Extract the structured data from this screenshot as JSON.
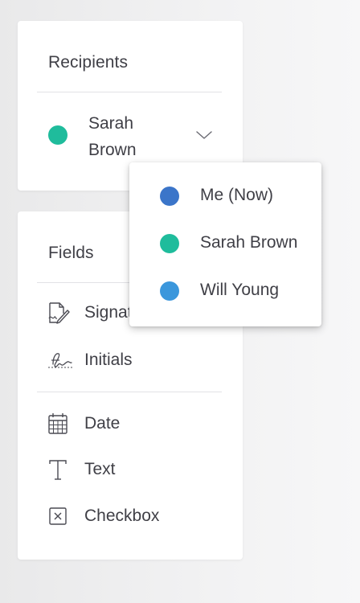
{
  "recipients_panel": {
    "title": "Recipients",
    "selected": {
      "name": "Sarah Brown",
      "color": "#1fbc9c"
    },
    "dropdown_icon": "chevron-down-icon"
  },
  "recipient_dropdown": {
    "options": [
      {
        "label": "Me (Now)",
        "color": "#3b75c9"
      },
      {
        "label": "Sarah Brown",
        "color": "#1fbc9c"
      },
      {
        "label": "Will Young",
        "color": "#3b97dc"
      }
    ]
  },
  "fields_panel": {
    "title": "Fields",
    "items": [
      {
        "label": "Signature",
        "icon": "signature-icon"
      },
      {
        "label": "Initials",
        "icon": "initials-icon"
      },
      {
        "label": "Date",
        "icon": "calendar-icon"
      },
      {
        "label": "Text",
        "icon": "text-icon"
      },
      {
        "label": "Checkbox",
        "icon": "checkbox-icon"
      }
    ]
  }
}
